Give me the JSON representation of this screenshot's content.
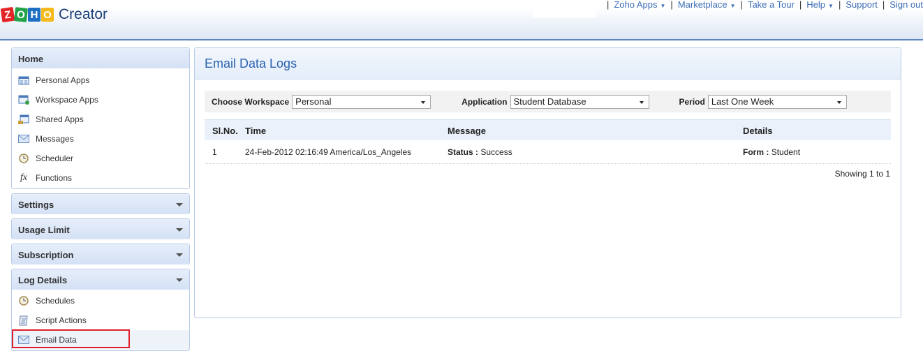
{
  "header": {
    "logo_letters": [
      "Z",
      "O",
      "H",
      "O"
    ],
    "product": "Creator",
    "links": [
      {
        "label": "Zoho Apps",
        "dropdown": true
      },
      {
        "label": "Marketplace",
        "dropdown": true
      },
      {
        "label": "Take a Tour",
        "dropdown": false
      },
      {
        "label": "Help",
        "dropdown": true
      },
      {
        "label": "Support",
        "dropdown": false
      },
      {
        "label": "Sign out",
        "dropdown": false
      }
    ]
  },
  "sidebar": {
    "home": {
      "title": "Home",
      "items": [
        "Personal Apps",
        "Workspace Apps",
        "Shared Apps",
        "Messages",
        "Scheduler",
        "Functions"
      ]
    },
    "settings": "Settings",
    "usage": "Usage Limit",
    "subscription": "Subscription",
    "logs": {
      "title": "Log Details",
      "items": [
        "Schedules",
        "Script Actions",
        "Email Data"
      ]
    }
  },
  "main": {
    "title": "Email Data Logs",
    "filters": {
      "workspace_label": "Choose Workspace",
      "workspace_value": "Personal",
      "application_label": "Application",
      "application_value": "Student Database",
      "period_label": "Period",
      "period_value": "Last One Week"
    },
    "columns": [
      "Sl.No.",
      "Time",
      "Message",
      "Details"
    ],
    "rows": [
      {
        "no": "1",
        "time": "24-Feb-2012 02:16:49 America/Los_Angeles",
        "msg_label": "Status :",
        "msg_value": "Success",
        "det_label": "Form :",
        "det_value": "Student"
      }
    ],
    "footer": "Showing 1 to 1"
  }
}
